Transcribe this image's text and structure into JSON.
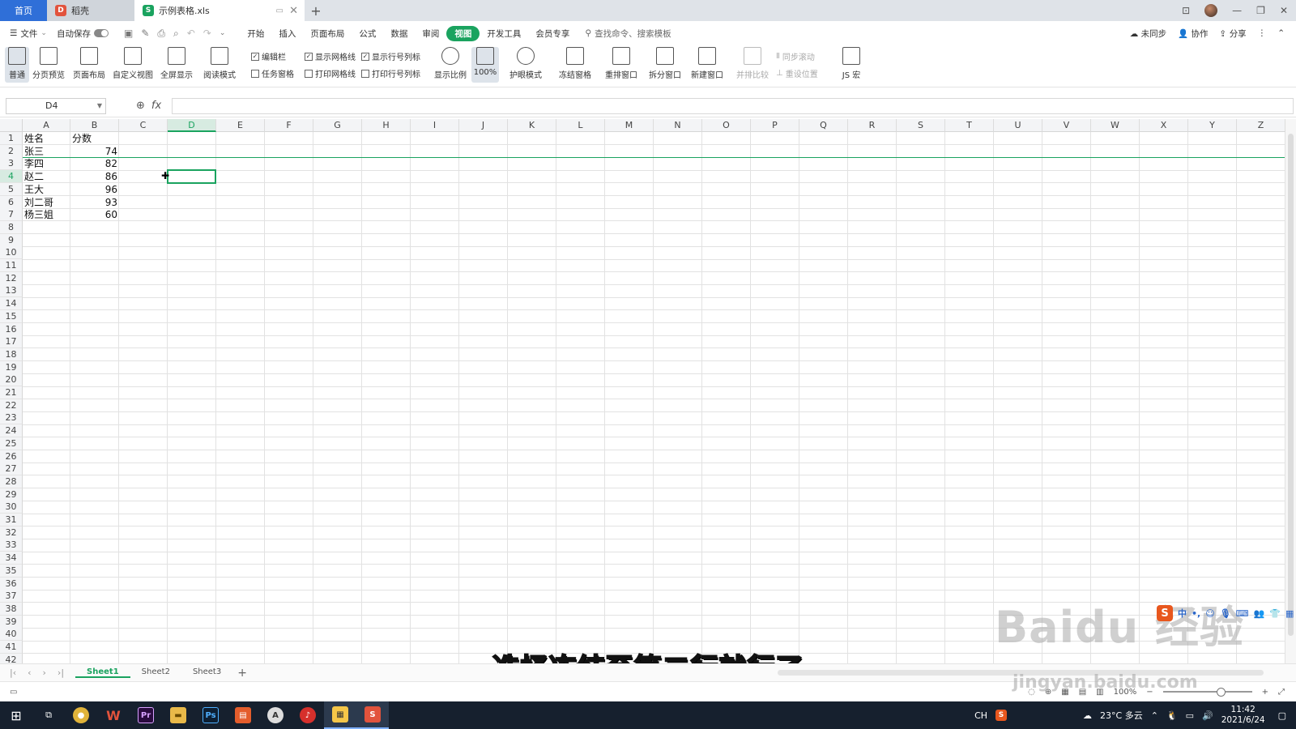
{
  "tabs": {
    "home": "首页",
    "stay": "稻壳",
    "file": "示例表格.xls"
  },
  "menu": {
    "file": "文件",
    "autosave": "自动保存",
    "items": [
      "开始",
      "插入",
      "页面布局",
      "公式",
      "数据",
      "审阅",
      "视图",
      "开发工具",
      "会员专享"
    ],
    "active_index": 6,
    "search": "查找命令、搜索模板",
    "sync": "未同步",
    "collab": "协作",
    "share": "分享"
  },
  "ribbon": {
    "normal": "普通",
    "page_break": "分页预览",
    "page_layout": "页面布局",
    "custom_view": "自定义视图",
    "fullscreen": "全屏显示",
    "reading": "阅读模式",
    "editbar": "编辑栏",
    "task_pane": "任务窗格",
    "show_grid": "显示网格线",
    "print_grid": "打印网格线",
    "show_headers": "显示行号列标",
    "print_headers": "打印行号列标",
    "zoom": "显示比例",
    "zoom100": "100%",
    "eye": "护眼模式",
    "freeze": "冻结窗格",
    "rearrange": "重排窗口",
    "split": "拆分窗口",
    "new_window": "新建窗口",
    "side_by_side": "并排比较",
    "sync_scroll": "同步滚动",
    "reset_pos": "重设位置",
    "macro": "JS 宏"
  },
  "formula": {
    "namebox": "D4",
    "fx": "fx",
    "content": ""
  },
  "columns": [
    "A",
    "B",
    "C",
    "D",
    "E",
    "F",
    "G",
    "H",
    "I",
    "J",
    "K",
    "L",
    "M",
    "N",
    "O",
    "P",
    "Q",
    "R",
    "S",
    "T",
    "U",
    "V",
    "W",
    "X",
    "Y",
    "Z"
  ],
  "active_col": "D",
  "active_row": 4,
  "rows_visible": 42,
  "table": {
    "header": [
      "姓名",
      "分数"
    ],
    "rows": [
      [
        "张三",
        "74"
      ],
      [
        "李四",
        "82"
      ],
      [
        "赵二",
        "86"
      ],
      [
        "王大",
        "96"
      ],
      [
        "刘二哥",
        "93"
      ],
      [
        "杨三姐",
        "60"
      ]
    ]
  },
  "sheets": [
    "Sheet1",
    "Sheet2",
    "Sheet3"
  ],
  "active_sheet": 0,
  "status": {
    "zoom": "100%"
  },
  "taskbar": {
    "weather": "23°C 多云",
    "ime": "CH",
    "time": "11:42",
    "date": "2021/6/24"
  },
  "ime_bar": {
    "lang": "中"
  },
  "watermark": {
    "brand": "Baidu 经验",
    "url": "jingyan.baidu.com"
  },
  "subtitle": "选择冻结至第二行就行了",
  "colors": {
    "accent": "#1aa35f",
    "home_tab": "#2f6fd8",
    "taskbar": "#16202e"
  }
}
